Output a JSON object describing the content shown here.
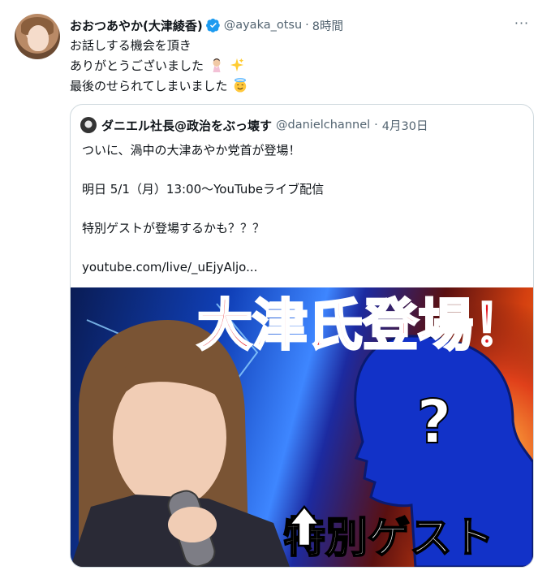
{
  "tweet": {
    "display_name": "おおつあやか(大津綾香)",
    "handle": "@ayaka_otsu",
    "separator": "·",
    "time": "8時間",
    "more": "···",
    "lines": [
      "お話しする機会を頂き",
      "ありがとうございました",
      "最後のせられてしまいました"
    ],
    "emojis": [
      "pleading-hands-emoji",
      "sparkles-emoji",
      "smiling-halo-emoji"
    ]
  },
  "quote": {
    "display_name": "ダニエル社長@政治をぶっ壊す",
    "handle": "@danielchannel",
    "separator": "·",
    "date": "4月30日",
    "lines": [
      "ついに、渦中の大津あやか党首が登場！",
      "明日 5/1（月）13:00〜YouTubeライブ配信",
      "特別ゲストが登場するかも？？？",
      "youtube.com/live/_uEjyAljo..."
    ],
    "thumbnail": {
      "headline": "大津氏登場！",
      "question_mark": "?",
      "caption": "特別ゲスト",
      "arrow_icon": "up-arrow-icon"
    }
  },
  "colors": {
    "verified": "#1d9bf0",
    "headline": "#e3121b",
    "silhouette": "#1232c8"
  }
}
